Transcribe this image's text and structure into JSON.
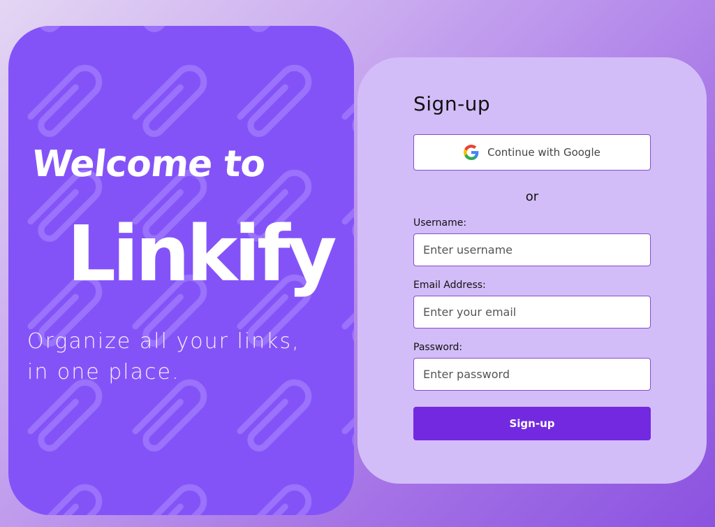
{
  "hero": {
    "welcome": "Welcome to",
    "brand": "Linkify",
    "tagline_line1": "Organize all your links,",
    "tagline_line2": "in one place.",
    "background_color": "#8453f8",
    "pattern_icon": "paperclip-icon"
  },
  "signup": {
    "title": "Sign-up",
    "google_button": "Continue with Google",
    "google_icon": "google-logo-icon",
    "divider": "or",
    "username_label": "Username:",
    "username_placeholder": "Enter username",
    "email_label": "Email Address:",
    "email_placeholder": "Enter your email",
    "password_label": "Password:",
    "password_placeholder": "Enter password",
    "submit_label": "Sign-up"
  },
  "colors": {
    "accent": "#7329e0",
    "card_background": "#d3bdf8",
    "input_border": "#7d4fd0"
  }
}
